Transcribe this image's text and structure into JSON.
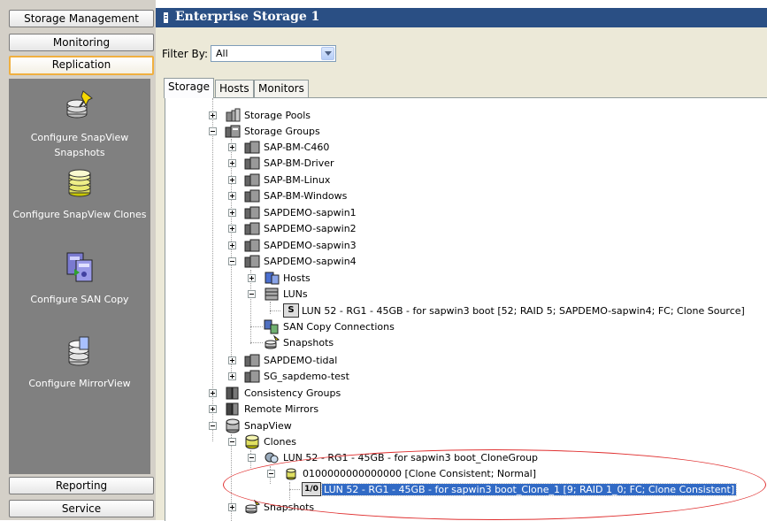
{
  "nav": {
    "storage_management": "Storage Management",
    "monitoring": "Monitoring",
    "replication": "Replication",
    "reporting": "Reporting",
    "service": "Service",
    "tasks": [
      {
        "label": "Configure SnapView Snapshots",
        "icon": "snapshot-config-icon"
      },
      {
        "label": "Configure SnapView Clones",
        "icon": "clone-config-icon"
      },
      {
        "label": "Configure SAN Copy",
        "icon": "san-copy-icon"
      },
      {
        "label": "Configure MirrorView",
        "icon": "mirrorview-icon"
      }
    ]
  },
  "header": {
    "title": "Enterprise Storage 1"
  },
  "filter": {
    "label": "Filter By:",
    "value": "All"
  },
  "tabs": [
    {
      "label": "Storage"
    },
    {
      "label": "Hosts"
    },
    {
      "label": "Monitors"
    }
  ],
  "tree": {
    "storage_pools": "Storage Pools",
    "storage_groups": "Storage Groups",
    "groups": [
      "SAP-BM-C460",
      "SAP-BM-Driver",
      "SAP-BM-Linux",
      "SAP-BM-Windows",
      "SAPDEMO-sapwin1",
      "SAPDEMO-sapwin2",
      "SAPDEMO-sapwin3",
      "SAPDEMO-sapwin4"
    ],
    "hosts": "Hosts",
    "luns": "LUNs",
    "lun_item": "LUN 52 - RG1 - 45GB - for sapwin3 boot [52; RAID 5; SAPDEMO-sapwin4; FC; Clone Source]",
    "lun_badge": "S",
    "san_copy_connections": "SAN Copy Connections",
    "snapshots": "Snapshots",
    "group_tidal": "SAPDEMO-tidal",
    "group_test": "SG_sapdemo-test",
    "consistency_groups": "Consistency Groups",
    "remote_mirrors": "Remote Mirrors",
    "snapview": "SnapView",
    "clones": "Clones",
    "clone_group": "LUN 52 - RG1 - 45GB - for sapwin3 boot_CloneGroup",
    "clone_id": "0100000000000000 [Clone Consistent; Normal]",
    "clone_lun": "LUN 52 - RG1 - 45GB - for sapwin3 boot_Clone_1 [9; RAID 1_0; FC; Clone Consistent]",
    "clone_badge": "1/0",
    "snapview_snapshots": "Snapshots"
  },
  "colors": {
    "title_bar": "#2a4f84",
    "nav_panel": "#808080",
    "selection": "#316ac5",
    "annotation": "#e03030"
  }
}
